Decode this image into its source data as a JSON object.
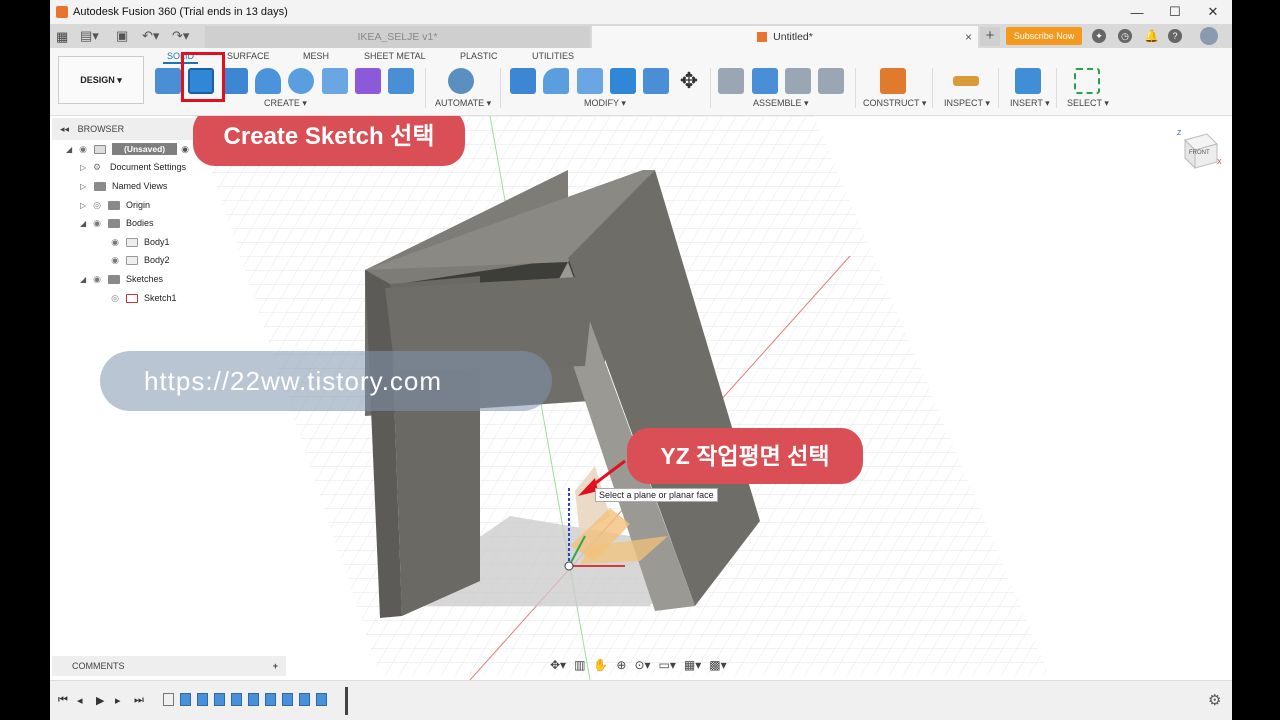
{
  "app": {
    "title": "Autodesk Fusion 360 (Trial ends in 13 days)"
  },
  "window_controls": {
    "minimize": "—",
    "maximize": "☐",
    "close": "✕"
  },
  "tabs": {
    "inactive_label": "IKEA_SELJE v1*",
    "active_label": "Untitled*",
    "close": "×",
    "new": "+"
  },
  "header": {
    "subscribe_label": "Subscribe Now"
  },
  "ribbon": {
    "design_label": "DESIGN ▾",
    "tabs": [
      "SOLID",
      "SURFACE",
      "MESH",
      "SHEET METAL",
      "PLASTIC",
      "UTILITIES"
    ],
    "groups": [
      "CREATE ▾",
      "AUTOMATE ▾",
      "MODIFY ▾",
      "ASSEMBLE ▾",
      "CONSTRUCT ▾",
      "INSPECT ▾",
      "INSERT ▾",
      "SELECT ▾"
    ]
  },
  "browser": {
    "title": "BROWSER",
    "items": [
      {
        "label": "(Unsaved)"
      },
      {
        "label": "Document Settings"
      },
      {
        "label": "Named Views"
      },
      {
        "label": "Origin"
      },
      {
        "label": "Bodies"
      },
      {
        "label": "Body1"
      },
      {
        "label": "Body2"
      },
      {
        "label": "Sketches"
      },
      {
        "label": "Sketch1"
      }
    ]
  },
  "annotations": {
    "create_sketch": "Create Sketch 선택",
    "yz_plane": "YZ 작업평면 선택",
    "watermark": "https://22ww.tistory.com"
  },
  "tooltip": {
    "text": "Select a plane or planar face"
  },
  "viewcube": {
    "face": "FRONT",
    "axis_z": "Z",
    "axis_x": "X"
  },
  "comments": {
    "title": "COMMENTS",
    "add": "+"
  },
  "colors": {
    "callout": "#d94f55",
    "highlight": "#e01020",
    "subscribe": "#f39a1e",
    "accent": "#1a73b8"
  }
}
